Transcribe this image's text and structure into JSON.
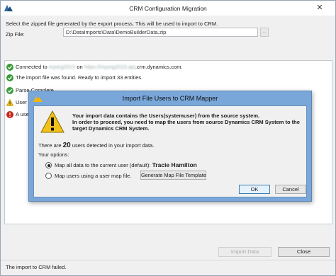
{
  "window": {
    "title": "CRM Configuration Migration",
    "close_glyph": "✕",
    "icon": "dynamics-crm-logo"
  },
  "instruction": "Select the zipped file generated by the export process. This will be used to import to CRM.",
  "zip": {
    "label": "Zip File:",
    "value": "D:\\DataImports\\Data\\DemoBuilderData.zip",
    "browse_label": "..."
  },
  "log": [
    {
      "icon": "success-check-icon",
      "prefix": "Connected to ",
      "masked_1": "myorg2015",
      "middle": " on ",
      "masked_2": "https://myorg2015.api",
      "suffix": ".crm.dynamics.com."
    },
    {
      "icon": "success-check-icon",
      "text": "The import file was found. Ready to import 33 entities."
    },
    {
      "icon": "success-check-icon",
      "text": "Parse Complete"
    },
    {
      "icon": "warning-icon",
      "text": "User M"
    },
    {
      "icon": "error-icon",
      "text": "A users"
    }
  ],
  "buttons": {
    "import": "Import Data",
    "close": "Close"
  },
  "status": "The import to CRM failed.",
  "dialog": {
    "title": "Import File Users to CRM Mapper",
    "message_lines": [
      "Your import data contains the Users(systemuser) from the source system.",
      "In order to proceed, you need to map the users from source Dynamics CRM System to the",
      "target Dynamics CRM System."
    ],
    "users_prefix": "There are ",
    "user_count": "20",
    "users_suffix": " users detected in your import data.",
    "options_label": "Your options:",
    "option_default": "Map all data to the current user (default): ",
    "current_user": "Tracie Hamilton",
    "option_map_file": "Map users using a user map file.",
    "generate_button": "Generate Map File Template",
    "ok": "OK",
    "cancel": "Cancel",
    "selected_option": "default"
  },
  "colors": {
    "success": "#3a9b3a",
    "warning": "#f2c21a",
    "error": "#c8231c",
    "dialog_frame": "#79a7d9"
  }
}
